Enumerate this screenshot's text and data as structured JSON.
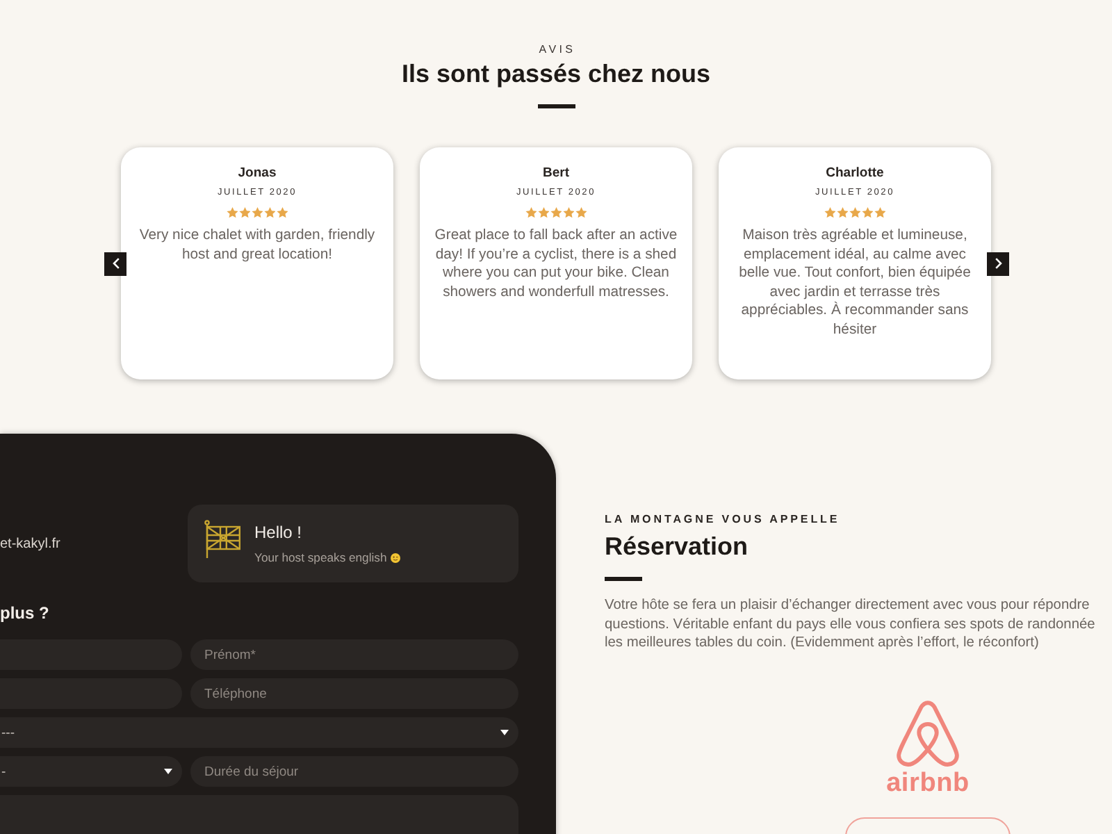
{
  "reviews": {
    "eyebrow": "AVIS",
    "title": "Ils sont passés chez nous",
    "items": [
      {
        "name": "Jonas",
        "date": "JUILLET 2020",
        "stars": 5,
        "text": "Very nice chalet with garden, friendly host and great location!"
      },
      {
        "name": "Bert",
        "date": "JUILLET 2020",
        "stars": 5,
        "text": "Great place to fall back after an active day! If you’re a cyclist, there is a shed where you can put your bike. Clean showers and wonderfull matresses."
      },
      {
        "name": "Charlotte",
        "date": "JUILLET 2020",
        "stars": 5,
        "text": "Maison très agréable et lumineuse, emplacement idéal, au calme avec belle vue. Tout confort, bien équipée avec jardin et terrasse très appréciables. À recommander sans hésiter"
      }
    ]
  },
  "reservation_panel": {
    "contact_text": "et-kakyl.fr",
    "language_card": {
      "title": "Hello !",
      "subtitle": "Your host speaks english"
    },
    "form_title": "plus ?",
    "form_rows": [
      [
        {
          "kind": "input"
        },
        {
          "kind": "input",
          "placeholder": "Prénom*"
        }
      ],
      [
        {
          "kind": "input"
        },
        {
          "kind": "input",
          "placeholder": "Téléphone"
        }
      ],
      [
        {
          "kind": "select",
          "value": "---"
        }
      ],
      [
        {
          "kind": "select",
          "value": "-"
        },
        {
          "kind": "input",
          "placeholder": "Durée du séjour"
        }
      ],
      [
        {
          "kind": "textarea"
        }
      ]
    ]
  },
  "reservation_info": {
    "eyebrow": "LA MONTAGNE VOUS APPELLE",
    "title": "Réservation",
    "text": "Votre hôte se fera un plaisir d’échanger directement avec vous pour répondre\nquestions. Véritable enfant du pays elle vous confiera ses spots de randonnée\nles meilleures tables du coin. (Evidemment après l’effort, le réconfort)",
    "logo_text": "airbnb"
  }
}
